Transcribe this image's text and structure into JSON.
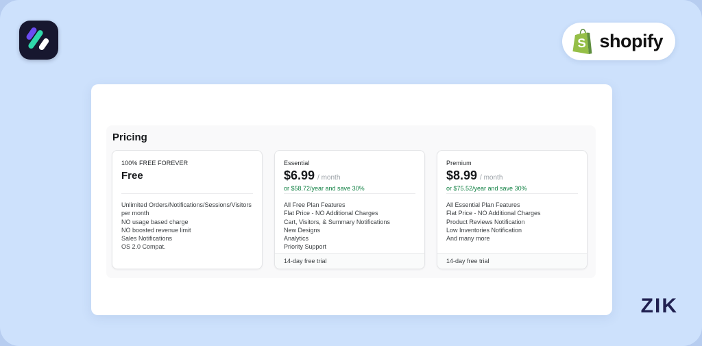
{
  "colors": {
    "accent_green": "#108043",
    "canvas_blue": "#cde1fc",
    "outer_blue": "#b7cdf0",
    "logo_navy": "#17172f",
    "logo_stripe_purple": "#6b4cf3",
    "logo_stripe_teal": "#2fd8ab",
    "logo_stripe_white": "#ffffff",
    "shopify_bag_green": "#95BF47",
    "shopify_bag_shadow": "#5E8E3E"
  },
  "branding": {
    "shopify_label": "shopify",
    "watermark": "ZIK"
  },
  "pricing": {
    "title": "Pricing",
    "plans": [
      {
        "label": "100% FREE FOREVER",
        "name": "Free",
        "features": [
          "Unlimited Orders/Notifications/Sessions/Visitors per month",
          "NO usage based charge",
          "NO boosted revenue limit",
          "Sales Notifications",
          "OS 2.0 Compat."
        ]
      },
      {
        "label": "Essential",
        "price": "$6.99",
        "period": "/ month",
        "yearly": "or $58.72/year and save 30%",
        "features": [
          "All Free Plan Features",
          "Flat Price - NO Additional Charges",
          "Cart, Visitors, & Summary Notifications",
          "New Designs",
          "Analytics",
          "Priority Support"
        ],
        "trial": "14-day free trial"
      },
      {
        "label": "Premium",
        "price": "$8.99",
        "period": "/ month",
        "yearly": "or $75.52/year and save 30%",
        "features": [
          "All Essential Plan Features",
          "Flat Price - NO Additional Charges",
          "Product Reviews Notification",
          "Low Inventories Notification",
          "And many more"
        ],
        "trial": "14-day free trial"
      }
    ]
  }
}
